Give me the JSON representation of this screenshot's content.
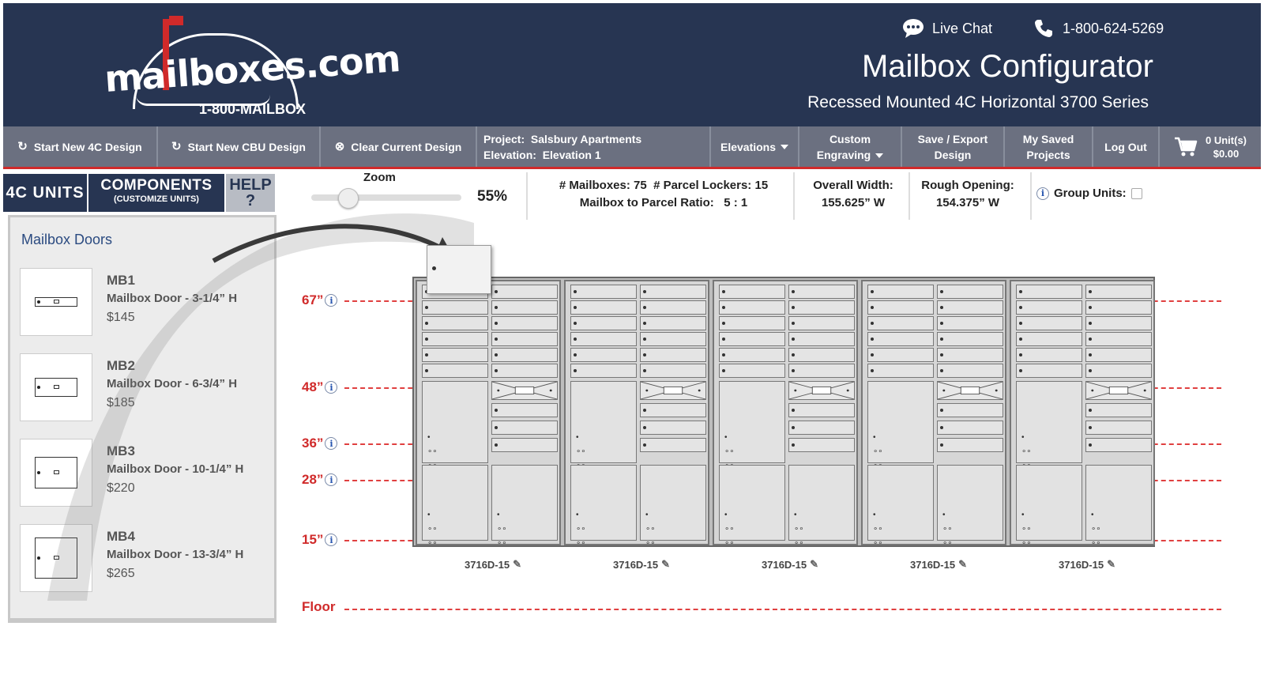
{
  "header": {
    "logo_text": "mailboxes.com",
    "logo_phone": "1-800-MAILBOX",
    "live_chat": "Live Chat",
    "phone": "1-800-624-5269",
    "title": "Mailbox Configurator",
    "subtitle": "Recessed Mounted 4C Horizontal 3700 Series"
  },
  "toolbar": {
    "start_4c": "Start New 4C Design",
    "start_cbu": "Start New CBU Design",
    "clear": "Clear Current Design",
    "project_label": "Project:",
    "project_value": "Salsbury Apartments",
    "elevation_label": "Elevation:",
    "elevation_value": "Elevation 1",
    "elevations": "Elevations",
    "custom_engraving_1": "Custom",
    "custom_engraving_2": "Engraving",
    "save_export_1": "Save / Export",
    "save_export_2": "Design",
    "my_saved_1": "My Saved",
    "my_saved_2": "Projects",
    "logout": "Log Out",
    "cart_units": "0 Unit(s)",
    "cart_total": "$0.00"
  },
  "tabs": {
    "units_4c": "4C UNITS",
    "components": "COMPONENTS",
    "components_sub": "(CUSTOMIZE UNITS)",
    "help": "HELP",
    "help_q": "?"
  },
  "zoom": {
    "label": "Zoom",
    "value": "55%",
    "level_percent": 55
  },
  "stats": {
    "mailboxes": "# Mailboxes: 75",
    "parcel_lockers": "# Parcel Lockers: 15",
    "ratio": "Mailbox to Parcel Ratio:   5 : 1",
    "overall_width_label": "Overall Width:",
    "overall_width_value": "155.625” W",
    "rough_opening_label": "Rough Opening:",
    "rough_opening_value": "154.375” W",
    "group_units": "Group Units:",
    "group_units_checked": false
  },
  "panel": {
    "title": "Mailbox Doors",
    "doors": [
      {
        "code": "MB1",
        "name": "Mailbox Door - 3-1/4” H",
        "price": "$145"
      },
      {
        "code": "MB2",
        "name": "Mailbox Door - 6-3/4” H",
        "price": "$185"
      },
      {
        "code": "MB3",
        "name": "Mailbox Door - 10-1/4” H",
        "price": "$220"
      },
      {
        "code": "MB4",
        "name": "Mailbox Door - 13-3/4” H",
        "price": "$265"
      }
    ]
  },
  "guides": [
    "67”",
    "48”",
    "36”",
    "28”",
    "15”",
    "Floor"
  ],
  "units": [
    "3716D-15",
    "3716D-15",
    "3716D-15",
    "3716D-15",
    "3716D-15"
  ],
  "colors": {
    "navy": "#273552",
    "toolbar_gray": "#6b7080",
    "accent_red": "#d02a2a"
  },
  "icons": {
    "chat": "chat-bubble-icon",
    "phone": "phone-icon",
    "refresh": "refresh-icon",
    "clear": "clear-circle-icon",
    "cart": "cart-icon",
    "info": "info-icon",
    "edit": "edit-icon"
  }
}
